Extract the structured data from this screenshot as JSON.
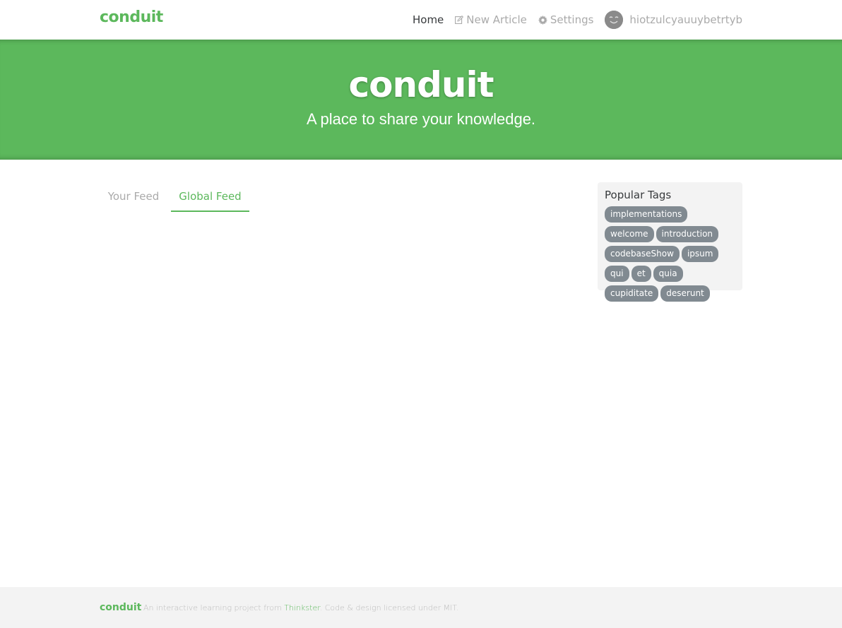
{
  "navbar": {
    "brand": "conduit",
    "items": [
      {
        "label": "Home",
        "icon": "",
        "active": true
      },
      {
        "label": "New Article",
        "icon": "compose-icon"
      },
      {
        "label": "Settings",
        "icon": "gear-icon"
      }
    ],
    "username": "hiotzulcyauuybetrtyb"
  },
  "banner": {
    "title": "conduit",
    "subtitle": "A place to share your knowledge."
  },
  "feed": {
    "tabs": [
      "Your Feed",
      "Global Feed"
    ],
    "active_tab": "Global Feed"
  },
  "sidebar": {
    "title": "Popular Tags",
    "tags": [
      "implementations",
      "welcome",
      "introduction",
      "codebaseShow",
      "ipsum",
      "qui",
      "et",
      "quia",
      "cupiditate",
      "deserunt"
    ]
  },
  "footer": {
    "logo": "conduit",
    "text_before": "An interactive learning project from ",
    "link": "Thinkster",
    "text_after": ". Code & design licensed under MIT."
  },
  "colors": {
    "brand": "#5cb85c",
    "tag": "#818a91"
  }
}
